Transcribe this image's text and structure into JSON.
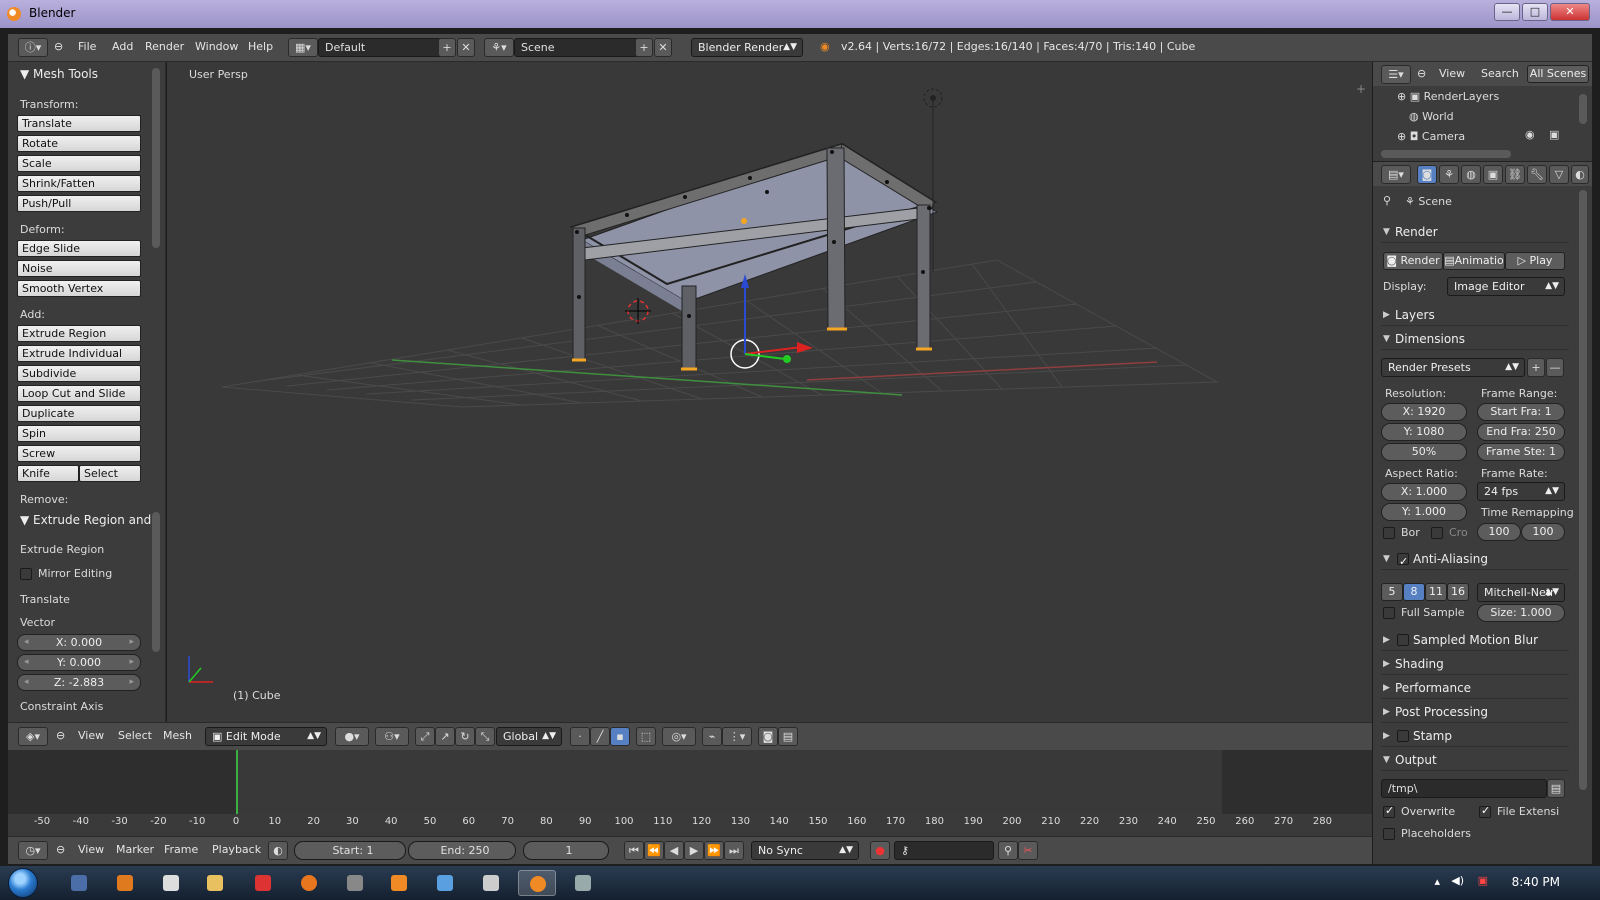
{
  "window": {
    "title": "Blender",
    "minimize": "—",
    "maximize": "□",
    "close": "✕"
  },
  "info": {
    "menus": [
      "File",
      "Add",
      "Render",
      "Window",
      "Help"
    ],
    "layout": "Default",
    "scene": "Scene",
    "engine": "Blender Render",
    "stats": "v2.64 | Verts:16/72 | Edges:16/140 | Faces:4/70 | Tris:140 | Cube"
  },
  "toolpanel": {
    "title": "Mesh Tools",
    "transform_label": "Transform:",
    "transform": [
      "Translate",
      "Rotate",
      "Scale",
      "Shrink/Fatten",
      "Push/Pull"
    ],
    "deform_label": "Deform:",
    "deform": [
      "Edge Slide",
      "Noise",
      "Smooth Vertex"
    ],
    "add_label": "Add:",
    "add": [
      "Extrude Region",
      "Extrude Individual",
      "Subdivide",
      "Loop Cut and Slide",
      "Duplicate",
      "Spin",
      "Screw"
    ],
    "knife": "Knife",
    "select": "Select",
    "remove_label": "Remove:",
    "operator_title": "Extrude Region and",
    "operator_name": "Extrude Region",
    "mirror_editing": "Mirror Editing",
    "translate": "Translate",
    "vector_label": "Vector",
    "vector_x": "X: 0.000",
    "vector_y": "Y: 0.000",
    "vector_z": "Z: -2.883",
    "constraint_axis": "Constraint Axis"
  },
  "viewport": {
    "view_label": "User Persp",
    "object_label": "(1) Cube"
  },
  "view3d_header": {
    "menus": [
      "View",
      "Select",
      "Mesh"
    ],
    "mode": "Edit Mode",
    "orientation": "Global"
  },
  "timeline": {
    "ticks": [
      "-50",
      "-40",
      "-30",
      "-20",
      "-10",
      "0",
      "10",
      "20",
      "30",
      "40",
      "50",
      "60",
      "70",
      "80",
      "90",
      "100",
      "110",
      "120",
      "130",
      "140",
      "150",
      "160",
      "170",
      "180",
      "190",
      "200",
      "210",
      "220",
      "230",
      "240",
      "250",
      "260",
      "270",
      "280"
    ],
    "menus": [
      "View",
      "Marker",
      "Frame",
      "Playback"
    ],
    "start": "Start: 1",
    "end": "End: 250",
    "current": "1",
    "sync": "No Sync",
    "current_frame": 0
  },
  "outliner": {
    "menus": [
      "View",
      "Search"
    ],
    "filter": "All Scenes",
    "items": [
      "RenderLayers",
      "World",
      "Camera"
    ]
  },
  "properties": {
    "scene_label": "Scene",
    "render_section": "Render",
    "render_btn": "Render",
    "animation_btn": "Animatio",
    "play_btn": "Play",
    "display_label": "Display:",
    "display_value": "Image Editor",
    "layers": "Layers",
    "dimensions": "Dimensions",
    "render_presets": "Render Presets",
    "resolution_label": "Resolution:",
    "res_x": "X: 1920",
    "res_y": "Y: 1080",
    "res_pct": "50%",
    "frame_range_label": "Frame Range:",
    "start_frame": "Start Fra: 1",
    "end_frame": "End Fra: 250",
    "frame_step": "Frame Ste: 1",
    "aspect_label": "Aspect Ratio:",
    "aspect_x": "X: 1.000",
    "aspect_y": "Y: 1.000",
    "frame_rate_label": "Frame Rate:",
    "frame_rate": "24 fps",
    "time_remap_label": "Time Remapping",
    "remap_old": "100",
    "remap_new": "100",
    "border": "Bor",
    "crop": "Cro",
    "anti_aliasing": "Anti-Aliasing",
    "aa_samples": [
      "5",
      "8",
      "11",
      "16"
    ],
    "aa_filter": "Mitchell-Netr",
    "full_sample": "Full Sample",
    "aa_size": "Size: 1.000",
    "motion_blur": "Sampled Motion Blur",
    "shading": "Shading",
    "performance": "Performance",
    "post_processing": "Post Processing",
    "stamp": "Stamp",
    "output": "Output",
    "output_path": "/tmp\\",
    "overwrite": "Overwrite",
    "file_ext": "File Extensi",
    "placeholders": "Placeholders"
  },
  "taskbar": {
    "clock": "8:40 PM"
  },
  "colors": {
    "accent": "#5680c2",
    "selection": "#f5a623",
    "frame_cursor": "#3cb043"
  }
}
